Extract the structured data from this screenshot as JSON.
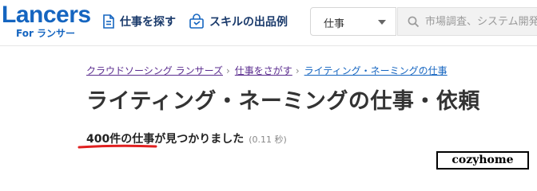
{
  "header": {
    "logo": {
      "main": "Lancers",
      "sub": "For ランサー"
    },
    "nav": [
      {
        "label": "仕事を探す",
        "icon": "document-icon"
      },
      {
        "label": "スキルの出品例",
        "icon": "shopping-bag-icon"
      }
    ],
    "category_select": {
      "value": "仕事"
    },
    "search": {
      "placeholder": "市場調査、システム開発",
      "value": ""
    }
  },
  "breadcrumb": [
    {
      "label": "クラウドソーシング ランサーズ"
    },
    {
      "label": "仕事をさがす"
    },
    {
      "label": "ライティング・ネーミングの仕事"
    }
  ],
  "page_title": "ライティング・ネーミングの仕事・依頼",
  "results": {
    "count_text": "400件の仕事が見つかりました",
    "time_text": "(0.11 秒)"
  },
  "watermark": "cozyhome",
  "colors": {
    "brand": "#1565c0",
    "nav_text": "#1a3a6b",
    "visited_link": "#5b2d8f",
    "annotation_underline": "#e02020"
  }
}
